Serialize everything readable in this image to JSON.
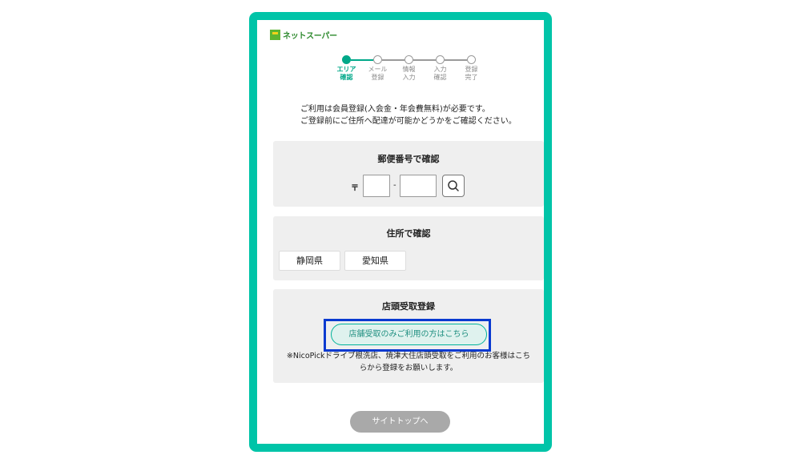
{
  "logo": {
    "text": "ネットスーパー"
  },
  "steps": [
    {
      "label": "エリア\n確認",
      "active": true
    },
    {
      "label": "メール\n登録",
      "active": false
    },
    {
      "label": "情報\n入力",
      "active": false
    },
    {
      "label": "入力\n確認",
      "active": false
    },
    {
      "label": "登録\n完了",
      "active": false
    }
  ],
  "intro": "ご利用は会員登録(入会金・年会費無料)が必要です。\nご登録前にご住所へ配達が可能かどうかをご確認ください。",
  "postal": {
    "title": "郵便番号で確認",
    "mark": "〒",
    "field1_value": "",
    "field2_value": "",
    "dash": "-"
  },
  "address": {
    "title": "住所で確認",
    "prefectures": [
      "静岡県",
      "愛知県"
    ]
  },
  "store": {
    "title": "店頭受取登録",
    "button_label": "店舗受取のみご利用の方はこちら",
    "note": "※NicoPickドライブ根洗店、焼津大住店頭受取をご利用のお客様はこち\nらから登録をお願いします。"
  },
  "footer": {
    "top_button": "サイトトップへ"
  },
  "colors": {
    "brand": "#00c4a8",
    "step_active": "#00a889",
    "highlight": "#0a3ad0"
  },
  "icons": {
    "search": "search-icon"
  }
}
